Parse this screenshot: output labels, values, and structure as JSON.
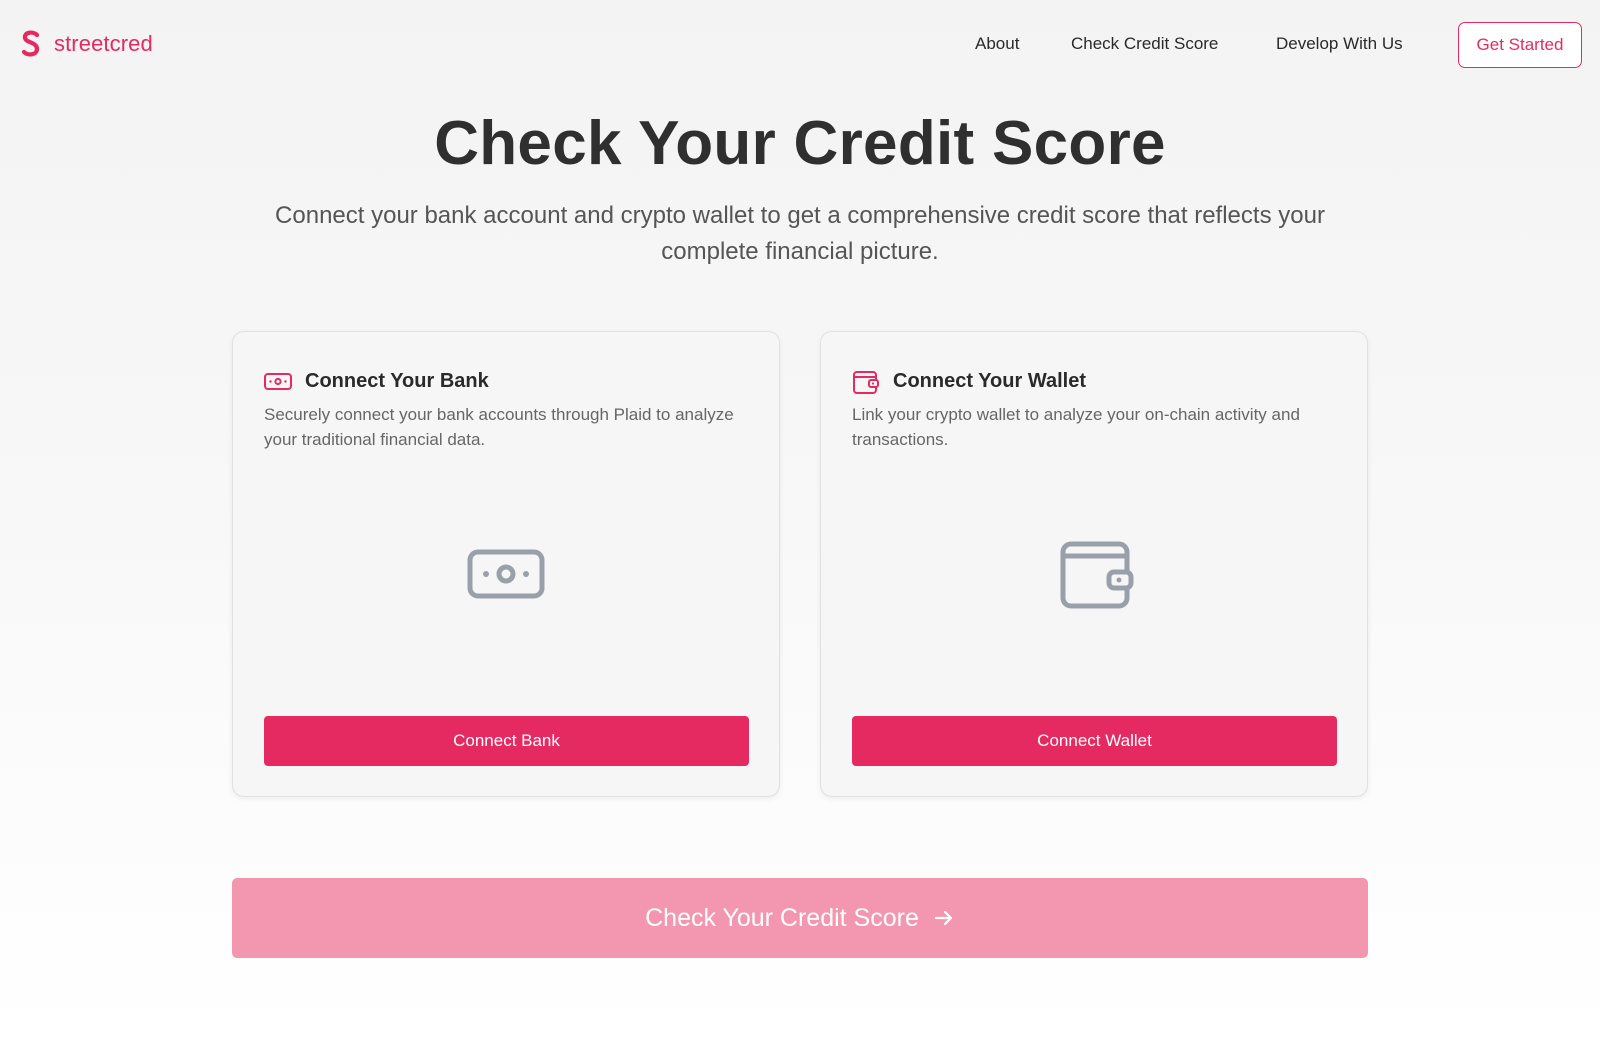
{
  "brand": {
    "name": "streetcred",
    "accent": "#e52a61",
    "icon": "s-logo-icon"
  },
  "nav": {
    "links": [
      {
        "label": "About"
      },
      {
        "label": "Check Credit Score"
      },
      {
        "label": "Develop With Us"
      }
    ],
    "cta": "Get Started"
  },
  "hero": {
    "title": "Check Your Credit Score",
    "subtitle": "Connect your bank account and crypto wallet to get a comprehensive credit score that reflects your complete financial picture."
  },
  "cards": {
    "bank": {
      "icon": "cash-icon",
      "title": "Connect Your Bank",
      "description": "Securely connect your bank accounts through Plaid to analyze your traditional financial data.",
      "button": "Connect Bank"
    },
    "wallet": {
      "icon": "wallet-icon",
      "title": "Connect Your Wallet",
      "description": "Link your crypto wallet to analyze your on-chain activity and transactions.",
      "button": "Connect Wallet"
    }
  },
  "cta": {
    "label": "Check Your Credit Score",
    "icon": "arrow-right-icon",
    "state": "disabled",
    "color": "#f396b0"
  }
}
